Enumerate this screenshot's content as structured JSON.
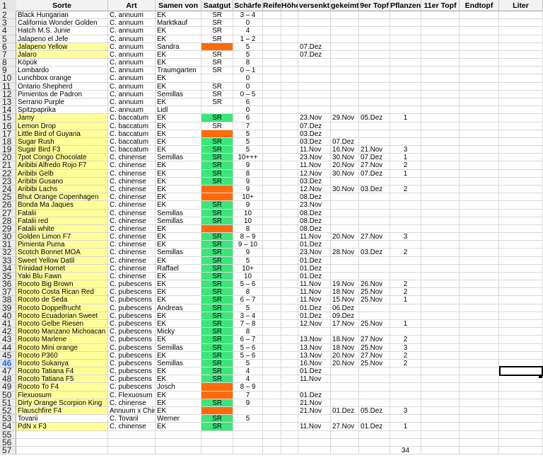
{
  "columns": {
    "row_header_first": "1",
    "a": "Sorte",
    "b": "Art",
    "c": "Samen von",
    "d": "Saatgut",
    "e": "Schärfe",
    "f": "Reife",
    "g": "Höhe",
    "h": "versenkt",
    "i": "gekeimt",
    "j": "9er Topf",
    "k": "Pflanzen",
    "l": "11er Topf",
    "m": "Endtopf",
    "n": "Liter"
  },
  "active_row": 46,
  "colors": {
    "yellow": "#ffff99",
    "green": "#3ce57a",
    "orange": "#ff6a0a",
    "active_row_num": "#2a6ad8"
  },
  "rows": [
    {
      "n": "2",
      "sorte": "Black Hungarian",
      "art": "C. annuum",
      "samen": "EK",
      "saat": "SR",
      "saat_color": "",
      "scharfe": "3 – 4",
      "versenkt": "",
      "gekeimt": "",
      "topf9": "",
      "pflanzen": "",
      "yellow": false
    },
    {
      "n": "3",
      "sorte": "California Wonder Golden",
      "art": "C. annuum",
      "samen": "Marktkauf",
      "saat": "SR",
      "saat_color": "",
      "scharfe": "0",
      "versenkt": "",
      "gekeimt": "",
      "topf9": "",
      "pflanzen": "",
      "yellow": false
    },
    {
      "n": "4",
      "sorte": "Hatch M.S. Junie",
      "art": "C. annuum",
      "samen": "EK",
      "saat": "SR",
      "saat_color": "",
      "scharfe": "4",
      "versenkt": "",
      "gekeimt": "",
      "topf9": "",
      "pflanzen": "",
      "yellow": false
    },
    {
      "n": "5",
      "sorte": "Jalapeno el Jefe",
      "art": "C. annuum",
      "samen": "EK",
      "saat": "SR",
      "saat_color": "",
      "scharfe": "1 – 2",
      "versenkt": "",
      "gekeimt": "",
      "topf9": "",
      "pflanzen": "",
      "yellow": false
    },
    {
      "n": "6",
      "sorte": "Jalapeno Yellow",
      "art": "C. annuum",
      "samen": "Sandra",
      "saat": "",
      "saat_color": "orange",
      "scharfe": "5",
      "versenkt": "07.Dez",
      "gekeimt": "",
      "topf9": "",
      "pflanzen": "",
      "yellow": true
    },
    {
      "n": "7",
      "sorte": "Jalaro",
      "art": "C. annuum",
      "samen": "EK",
      "saat": "SR",
      "saat_color": "",
      "scharfe": "5",
      "versenkt": "07.Dez",
      "gekeimt": "",
      "topf9": "",
      "pflanzen": "",
      "yellow": true
    },
    {
      "n": "8",
      "sorte": "Köpük",
      "art": "C. annuum",
      "samen": "EK",
      "saat": "SR",
      "saat_color": "",
      "scharfe": "8",
      "versenkt": "",
      "gekeimt": "",
      "topf9": "",
      "pflanzen": "",
      "yellow": false
    },
    {
      "n": "9",
      "sorte": "Lombardo",
      "art": "C. annuum",
      "samen": "Traumgarten",
      "saat": "SR",
      "saat_color": "",
      "scharfe": "0 – 1",
      "versenkt": "",
      "gekeimt": "",
      "topf9": "",
      "pflanzen": "",
      "yellow": false
    },
    {
      "n": "10",
      "sorte": "Lunchbox orange",
      "art": "C. annuum",
      "samen": "EK",
      "saat": "",
      "saat_color": "",
      "scharfe": "0",
      "versenkt": "",
      "gekeimt": "",
      "topf9": "",
      "pflanzen": "",
      "yellow": false
    },
    {
      "n": "11",
      "sorte": "Ontario Shepherd",
      "art": "C. annuum",
      "samen": "EK",
      "saat": "SR",
      "saat_color": "",
      "scharfe": "0",
      "versenkt": "",
      "gekeimt": "",
      "topf9": "",
      "pflanzen": "",
      "yellow": false
    },
    {
      "n": "12",
      "sorte": "Pimientos de Padron",
      "art": "C. annuum",
      "samen": "Semillas",
      "saat": "SR",
      "saat_color": "",
      "scharfe": "0 – 5",
      "versenkt": "",
      "gekeimt": "",
      "topf9": "",
      "pflanzen": "",
      "yellow": false
    },
    {
      "n": "13",
      "sorte": "Serrano Purple",
      "art": "C. annuum",
      "samen": "EK",
      "saat": "SR",
      "saat_color": "",
      "scharfe": "6",
      "versenkt": "",
      "gekeimt": "",
      "topf9": "",
      "pflanzen": "",
      "yellow": false
    },
    {
      "n": "14",
      "sorte": "Spitzpaprika",
      "art": "C. annuum",
      "samen": "Lidl",
      "saat": "",
      "saat_color": "",
      "scharfe": "0",
      "versenkt": "",
      "gekeimt": "",
      "topf9": "",
      "pflanzen": "",
      "yellow": false
    },
    {
      "n": "15",
      "sorte": "Jamy",
      "art": "C. baccatum",
      "samen": "EK",
      "saat": "SR",
      "saat_color": "green",
      "scharfe": "6",
      "versenkt": "23.Nov",
      "gekeimt": "29.Nov",
      "topf9": "05.Dez",
      "pflanzen": "1",
      "yellow": true
    },
    {
      "n": "16",
      "sorte": "Lemon Drop",
      "art": "C. baccatum",
      "samen": "EK",
      "saat": "SR",
      "saat_color": "",
      "scharfe": "7",
      "versenkt": "07.Dez",
      "gekeimt": "",
      "topf9": "",
      "pflanzen": "",
      "yellow": true
    },
    {
      "n": "17",
      "sorte": "Little Bird of Guyana",
      "art": "C. baccatum",
      "samen": "EK",
      "saat": "",
      "saat_color": "orange",
      "scharfe": "5",
      "versenkt": "03.Dez",
      "gekeimt": "",
      "topf9": "",
      "pflanzen": "",
      "yellow": true
    },
    {
      "n": "18",
      "sorte": "Sugar Rush",
      "art": "C. baccatum",
      "samen": "EK",
      "saat": "SR",
      "saat_color": "green",
      "scharfe": "5",
      "versenkt": "03.Dez",
      "gekeimt": "07.Dez",
      "topf9": "",
      "pflanzen": "",
      "yellow": true
    },
    {
      "n": "19",
      "sorte": "Sugar Bird F3",
      "art": "C. baccatum",
      "samen": "EK",
      "saat": "SR",
      "saat_color": "green",
      "scharfe": "5",
      "versenkt": "11.Nov",
      "gekeimt": "16.Nov",
      "topf9": "21.Nov",
      "pflanzen": "3",
      "yellow": true
    },
    {
      "n": "20",
      "sorte": "7pot Congo Chocolate",
      "art": "C. chinense",
      "samen": "Semillas",
      "saat": "SR",
      "saat_color": "green",
      "scharfe": "10+++",
      "versenkt": "23.Nov",
      "gekeimt": "30.Nov",
      "topf9": "07.Dez",
      "pflanzen": "1",
      "yellow": true
    },
    {
      "n": "21",
      "sorte": "Aribibi Alfredo Rojo F7",
      "art": "C. chinense",
      "samen": "EK",
      "saat": "SR",
      "saat_color": "green",
      "scharfe": "9",
      "versenkt": "11.Nov",
      "gekeimt": "20.Nov",
      "topf9": "27.Nov",
      "pflanzen": "2",
      "yellow": true
    },
    {
      "n": "22",
      "sorte": "Aribibi Gelb",
      "art": "C. chinense",
      "samen": "EK",
      "saat": "SR",
      "saat_color": "green",
      "scharfe": "8",
      "versenkt": "12.Nov",
      "gekeimt": "30.Nov",
      "topf9": "07.Dez",
      "pflanzen": "1",
      "yellow": true
    },
    {
      "n": "23",
      "sorte": "Aribibi Gusano",
      "art": "C. chinense",
      "samen": "EK",
      "saat": "SR",
      "saat_color": "green",
      "scharfe": "9",
      "versenkt": "03.Dez",
      "gekeimt": "",
      "topf9": "",
      "pflanzen": "",
      "yellow": true
    },
    {
      "n": "24",
      "sorte": "Aribibi Lachs",
      "art": "C. chinense",
      "samen": "EK",
      "saat": "",
      "saat_color": "orange",
      "scharfe": "9",
      "versenkt": "12.Nov",
      "gekeimt": "30.Nov",
      "topf9": "03.Dez",
      "pflanzen": "2",
      "yellow": true
    },
    {
      "n": "25",
      "sorte": "Bhut Orange Copenhagen",
      "art": "C. chinense",
      "samen": "EK",
      "saat": "",
      "saat_color": "orange",
      "scharfe": "10+",
      "versenkt": "08.Dez",
      "gekeimt": "",
      "topf9": "",
      "pflanzen": "",
      "yellow": true
    },
    {
      "n": "26",
      "sorte": "Bonda Ma Jaques",
      "art": "C. chinense",
      "samen": "EK",
      "saat": "SR",
      "saat_color": "green",
      "scharfe": "9",
      "versenkt": "23.Nov",
      "gekeimt": "",
      "topf9": "",
      "pflanzen": "",
      "yellow": true
    },
    {
      "n": "27",
      "sorte": "Fatalii",
      "art": "C. chinense",
      "samen": "Semillas",
      "saat": "SR",
      "saat_color": "green",
      "scharfe": "10",
      "versenkt": "08.Dez",
      "gekeimt": "",
      "topf9": "",
      "pflanzen": "",
      "yellow": true
    },
    {
      "n": "28",
      "sorte": "Fatalii red",
      "art": "C. chinense",
      "samen": "Semillas",
      "saat": "SR",
      "saat_color": "green",
      "scharfe": "10",
      "versenkt": "08.Dez",
      "gekeimt": "",
      "topf9": "",
      "pflanzen": "",
      "yellow": true
    },
    {
      "n": "29",
      "sorte": "Fatalii white",
      "art": "C. chinense",
      "samen": "EK",
      "saat": "",
      "saat_color": "orange",
      "scharfe": "8",
      "versenkt": "08.Dez",
      "gekeimt": "",
      "topf9": "",
      "pflanzen": "",
      "yellow": true
    },
    {
      "n": "30",
      "sorte": "Golden Limon F7",
      "art": "C. chinense",
      "samen": "EK",
      "saat": "SR",
      "saat_color": "green",
      "scharfe": "8 – 9",
      "versenkt": "11.Nov",
      "gekeimt": "20.Nov",
      "topf9": "27.Nov",
      "pflanzen": "3",
      "yellow": true
    },
    {
      "n": "31",
      "sorte": "Pimienta Puma",
      "art": "C. chinense",
      "samen": "EK",
      "saat": "SR",
      "saat_color": "green",
      "scharfe": "9 – 10",
      "versenkt": "01.Dez",
      "gekeimt": "",
      "topf9": "",
      "pflanzen": "",
      "yellow": true
    },
    {
      "n": "32",
      "sorte": "Scotch Bonnet MOA",
      "art": "C. chinense",
      "samen": "Semillas",
      "saat": "SR",
      "saat_color": "green",
      "scharfe": "9",
      "versenkt": "23.Nov",
      "gekeimt": "28.Nov",
      "topf9": "03.Dez",
      "pflanzen": "2",
      "yellow": true
    },
    {
      "n": "33",
      "sorte": "Sweet Yellow Datil",
      "art": "C. chinense",
      "samen": "EK",
      "saat": "SR",
      "saat_color": "green",
      "scharfe": "5",
      "versenkt": "01.Dez",
      "gekeimt": "",
      "topf9": "",
      "pflanzen": "",
      "yellow": true
    },
    {
      "n": "34",
      "sorte": "Trinidad Hornet",
      "art": "C. chinense",
      "samen": "Raffael",
      "saat": "SR",
      "saat_color": "green",
      "scharfe": "10+",
      "versenkt": "01.Dez",
      "gekeimt": "",
      "topf9": "",
      "pflanzen": "",
      "yellow": true
    },
    {
      "n": "35",
      "sorte": "Yaki Blu Fawn",
      "art": "C. chinense",
      "samen": "EK",
      "saat": "SR",
      "saat_color": "green",
      "scharfe": "10",
      "versenkt": "01.Dez",
      "gekeimt": "",
      "topf9": "",
      "pflanzen": "",
      "yellow": true
    },
    {
      "n": "36",
      "sorte": "Rocoto Big Brown",
      "art": "C. pubescens",
      "samen": "EK",
      "saat": "SR",
      "saat_color": "green",
      "scharfe": "5 – 6",
      "versenkt": "11.Nov",
      "gekeimt": "19.Nov",
      "topf9": "26.Nov",
      "pflanzen": "2",
      "yellow": true
    },
    {
      "n": "37",
      "sorte": "Rocoto Costa Rican Red",
      "art": "C. pubescens",
      "samen": "EK",
      "saat": "SR",
      "saat_color": "green",
      "scharfe": "8",
      "versenkt": "11.Nov",
      "gekeimt": "18.Nov",
      "topf9": "25.Nov",
      "pflanzen": "2",
      "yellow": true
    },
    {
      "n": "38",
      "sorte": "Rocoto de Seda",
      "art": "C. pubescens",
      "samen": "EK",
      "saat": "SR",
      "saat_color": "green",
      "scharfe": "6 – 7",
      "versenkt": "11.Nov",
      "gekeimt": "15.Nov",
      "topf9": "25.Nov",
      "pflanzen": "1",
      "yellow": true
    },
    {
      "n": "39",
      "sorte": "Rocoto Doppelfrucht",
      "art": "C. pubescens",
      "samen": "Andreas",
      "saat": "SR",
      "saat_color": "green",
      "scharfe": "5",
      "versenkt": "01.Dez",
      "gekeimt": "06.Dez",
      "topf9": "",
      "pflanzen": "",
      "yellow": true
    },
    {
      "n": "40",
      "sorte": "Rocoto Ecuadorian Sweet",
      "art": "C. pubescens",
      "samen": "EK",
      "saat": "SR",
      "saat_color": "green",
      "scharfe": "3 – 4",
      "versenkt": "01.Dez",
      "gekeimt": "09.Dez",
      "topf9": "",
      "pflanzen": "",
      "yellow": true
    },
    {
      "n": "41",
      "sorte": "Rocoto Gelbe Riesen",
      "art": "C. pubescens",
      "samen": "EK",
      "saat": "SR",
      "saat_color": "green",
      "scharfe": "7 – 8",
      "versenkt": "12.Nov",
      "gekeimt": "17.Nov",
      "topf9": "25.Nov",
      "pflanzen": "1",
      "yellow": true
    },
    {
      "n": "42",
      "sorte": "Rocoto Manzano Michoacan",
      "art": "C. pubescens",
      "samen": "Micky",
      "saat": "SR",
      "saat_color": "green",
      "scharfe": "8",
      "versenkt": "",
      "gekeimt": "",
      "topf9": "",
      "pflanzen": "",
      "yellow": true
    },
    {
      "n": "43",
      "sorte": "Rocoto Marlene",
      "art": "C. pubescens",
      "samen": "EK",
      "saat": "SR",
      "saat_color": "green",
      "scharfe": "6 – 7",
      "versenkt": "13.Nov",
      "gekeimt": "18.Nov",
      "topf9": "27.Nov",
      "pflanzen": "2",
      "yellow": true
    },
    {
      "n": "44",
      "sorte": "Rocoto Mini orange",
      "art": "C. pubescens",
      "samen": "Semillas",
      "saat": "SR",
      "saat_color": "green",
      "scharfe": "5 – 6",
      "versenkt": "13.Nov",
      "gekeimt": "18.Nov",
      "topf9": "25.Nov",
      "pflanzen": "3",
      "yellow": true
    },
    {
      "n": "45",
      "sorte": "Rocoto P360",
      "art": "C. pubescens",
      "samen": "EK",
      "saat": "SR",
      "saat_color": "green",
      "scharfe": "5 – 6",
      "versenkt": "13.Nov",
      "gekeimt": "20.Nov",
      "topf9": "27.Nov",
      "pflanzen": "2",
      "yellow": true
    },
    {
      "n": "46",
      "sorte": "Rocoto Sukanya",
      "art": "C. pubescens",
      "samen": "Semillas",
      "saat": "SR",
      "saat_color": "green",
      "scharfe": "5",
      "versenkt": "16.Nov",
      "gekeimt": "20.Nov",
      "topf9": "25.Nov",
      "pflanzen": "2",
      "yellow": true
    },
    {
      "n": "47",
      "sorte": "Rocoto Tatiana F4",
      "art": "C. pubescens",
      "samen": "EK",
      "saat": "SR",
      "saat_color": "green",
      "scharfe": "4",
      "versenkt": "01.Dez",
      "gekeimt": "",
      "topf9": "",
      "pflanzen": "",
      "yellow": true
    },
    {
      "n": "48",
      "sorte": "Rocoto Tatiana F5",
      "art": "C. pubescens",
      "samen": "EK",
      "saat": "SR",
      "saat_color": "green",
      "scharfe": "4",
      "versenkt": "11.Nov",
      "gekeimt": "",
      "topf9": "",
      "pflanzen": "",
      "yellow": true
    },
    {
      "n": "49",
      "sorte": "Rocoto To F4",
      "art": "C. pubescens",
      "samen": "Josch",
      "saat": "",
      "saat_color": "orange",
      "scharfe": "8 – 9",
      "versenkt": "",
      "gekeimt": "",
      "topf9": "",
      "pflanzen": "",
      "yellow": true
    },
    {
      "n": "50",
      "sorte": "Flexuosum",
      "art": "C. Flexuosum",
      "samen": "EK",
      "saat": "",
      "saat_color": "orange",
      "scharfe": "7",
      "versenkt": "01.Dez",
      "gekeimt": "",
      "topf9": "",
      "pflanzen": "",
      "yellow": true
    },
    {
      "n": "51",
      "sorte": "Dirty Orange Scorpion King",
      "art": "C. chinense",
      "samen": "EK",
      "saat": "SR",
      "saat_color": "green",
      "scharfe": "9",
      "versenkt": "21.Nov",
      "gekeimt": "",
      "topf9": "",
      "pflanzen": "",
      "yellow": true
    },
    {
      "n": "52",
      "sorte": "Flauschfire F4",
      "art": "Annuum x Chin",
      "samen": "EK",
      "saat": "",
      "saat_color": "orange",
      "scharfe": "",
      "versenkt": "21.Nov",
      "gekeimt": "01.Dez",
      "topf9": "05.Dez",
      "pflanzen": "3",
      "yellow": true
    },
    {
      "n": "53",
      "sorte": "Tovarii",
      "art": "C. Tovarii",
      "samen": "Werner",
      "saat": "SR",
      "saat_color": "green",
      "scharfe": "5",
      "versenkt": "",
      "gekeimt": "",
      "topf9": "",
      "pflanzen": "",
      "yellow": false
    },
    {
      "n": "54",
      "sorte": "PdN x  F3",
      "art": "C. chinense",
      "samen": "EK",
      "saat": "SR",
      "saat_color": "green",
      "scharfe": "",
      "versenkt": "11.Nov",
      "gekeimt": "27.Nov",
      "topf9": "01.Dez",
      "pflanzen": "1",
      "yellow": true
    },
    {
      "n": "55",
      "sorte": "",
      "art": "",
      "samen": "",
      "saat": "",
      "saat_color": "",
      "scharfe": "",
      "versenkt": "",
      "gekeimt": "",
      "topf9": "",
      "pflanzen": "",
      "yellow": false
    },
    {
      "n": "56",
      "sorte": "",
      "art": "",
      "samen": "",
      "saat": "",
      "saat_color": "",
      "scharfe": "",
      "versenkt": "",
      "gekeimt": "",
      "topf9": "",
      "pflanzen": "",
      "yellow": false
    },
    {
      "n": "57",
      "sorte": "",
      "art": "",
      "samen": "",
      "saat": "",
      "saat_color": "",
      "scharfe": "",
      "versenkt": "",
      "gekeimt": "",
      "topf9": "",
      "pflanzen": "34",
      "yellow": false
    }
  ]
}
